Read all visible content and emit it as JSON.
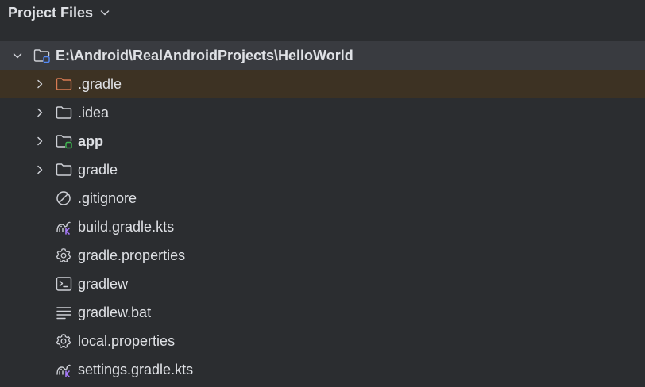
{
  "panel": {
    "title": "Project Files"
  },
  "tree": {
    "root": {
      "label": "E:\\Android\\RealAndroidProjects\\HelloWorld",
      "expanded": true
    },
    "items": [
      {
        "label": ".gradle",
        "icon": "folder-excluded-icon",
        "expandable": true,
        "bold": false
      },
      {
        "label": ".idea",
        "icon": "folder-icon",
        "expandable": true,
        "bold": false
      },
      {
        "label": "app",
        "icon": "module-folder-icon",
        "expandable": true,
        "bold": true
      },
      {
        "label": "gradle",
        "icon": "folder-icon",
        "expandable": true,
        "bold": false
      },
      {
        "label": ".gitignore",
        "icon": "ignore-file-icon",
        "expandable": false,
        "bold": false
      },
      {
        "label": "build.gradle.kts",
        "icon": "gradle-kotlin-icon",
        "expandable": false,
        "bold": false
      },
      {
        "label": "gradle.properties",
        "icon": "gear-icon",
        "expandable": false,
        "bold": false
      },
      {
        "label": "gradlew",
        "icon": "terminal-icon",
        "expandable": false,
        "bold": false
      },
      {
        "label": "gradlew.bat",
        "icon": "text-file-icon",
        "expandable": false,
        "bold": false
      },
      {
        "label": "local.properties",
        "icon": "gear-icon",
        "expandable": false,
        "bold": false
      },
      {
        "label": "settings.gradle.kts",
        "icon": "gradle-kotlin-icon",
        "expandable": false,
        "bold": false
      }
    ]
  },
  "colors": {
    "background": "#2b2d30",
    "root_highlight": "#393b40",
    "ignored_highlight": "#3d3223",
    "ignored_folder": "#d77b53",
    "module_marker": "#3fb950",
    "root_marker": "#548af7",
    "kotlin_accent": "#a97bff",
    "text": "#dfe1e5",
    "icon_stroke": "#ced0d6"
  }
}
